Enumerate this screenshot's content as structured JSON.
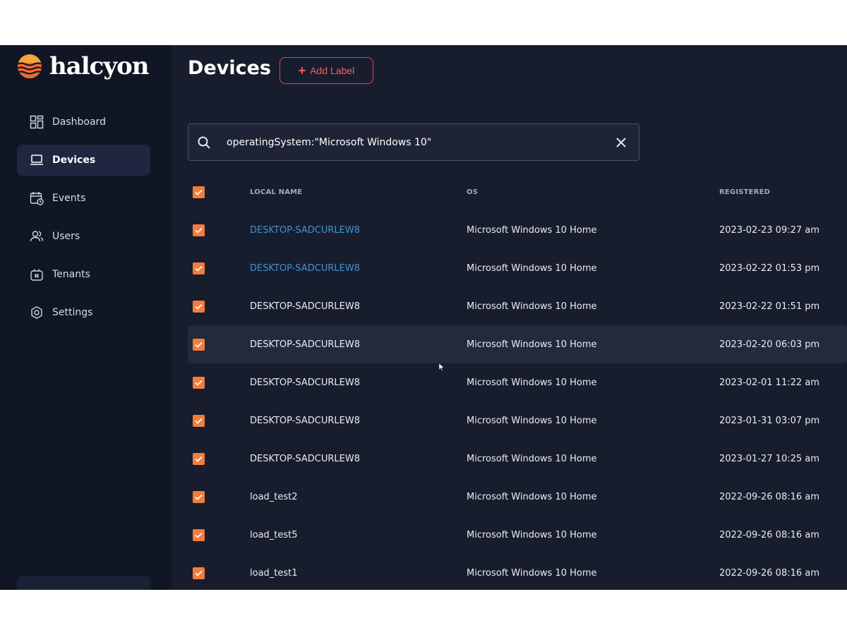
{
  "app": {
    "name": "halcyon"
  },
  "sidebar": {
    "items": [
      {
        "label": "Dashboard",
        "icon": "dashboard-grid-icon"
      },
      {
        "label": "Devices",
        "icon": "laptop-icon",
        "active": true
      },
      {
        "label": "Events",
        "icon": "calendar-clock-icon"
      },
      {
        "label": "Users",
        "icon": "users-icon"
      },
      {
        "label": "Tenants",
        "icon": "tenant-icon"
      },
      {
        "label": "Settings",
        "icon": "gear-icon"
      }
    ]
  },
  "header": {
    "title": "Devices",
    "add_label": "Add Label"
  },
  "search": {
    "value": "operatingSystem:\"Microsoft Windows 10\""
  },
  "table": {
    "columns": {
      "local_name": "LOCAL NAME",
      "os": "OS",
      "registered": "REGISTERED"
    },
    "rows": [
      {
        "name": "DESKTOP-SADCURLEW8",
        "os": "Microsoft Windows 10 Home",
        "registered": "2023-02-23 09:27 am",
        "link": true
      },
      {
        "name": "DESKTOP-SADCURLEW8",
        "os": "Microsoft Windows 10 Home",
        "registered": "2023-02-22 01:53 pm",
        "link": true
      },
      {
        "name": "DESKTOP-SADCURLEW8",
        "os": "Microsoft Windows 10 Home",
        "registered": "2023-02-22 01:51 pm"
      },
      {
        "name": "DESKTOP-SADCURLEW8",
        "os": "Microsoft Windows 10 Home",
        "registered": "2023-02-20 06:03 pm",
        "hover": true
      },
      {
        "name": "DESKTOP-SADCURLEW8",
        "os": "Microsoft Windows 10 Home",
        "registered": "2023-02-01 11:22 am"
      },
      {
        "name": "DESKTOP-SADCURLEW8",
        "os": "Microsoft Windows 10 Home",
        "registered": "2023-01-31 03:07 pm"
      },
      {
        "name": "DESKTOP-SADCURLEW8",
        "os": "Microsoft Windows 10 Home",
        "registered": "2023-01-27 10:25 am"
      },
      {
        "name": "load_test2",
        "os": "Microsoft Windows 10 Home",
        "registered": "2022-09-26 08:16 am"
      },
      {
        "name": "load_test5",
        "os": "Microsoft Windows 10 Home",
        "registered": "2022-09-26 08:16 am"
      },
      {
        "name": "load_test1",
        "os": "Microsoft Windows 10 Home",
        "registered": "2022-09-26 08:16 am"
      }
    ]
  },
  "colors": {
    "accent": "#f47c3b",
    "danger": "#e0444d",
    "link": "#3f92d6",
    "sidebar_bg": "#111625",
    "main_bg": "#181d2d"
  }
}
